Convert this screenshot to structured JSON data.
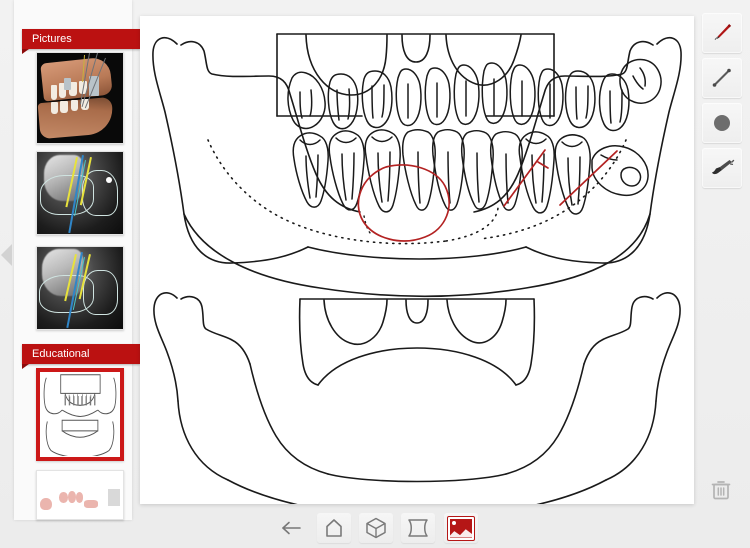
{
  "app": {
    "title": "Dental Panoramic Viewer",
    "background_color": "#efefef",
    "accent_color": "#bb1111",
    "annotation_color": "#b32222"
  },
  "sidebar": {
    "collapse_arrow": "chevron-left-icon",
    "sections": [
      {
        "label": "Pictures",
        "items": [
          {
            "name": "3d-dental-scan",
            "caption": "3D dental scan with implants",
            "selected": false
          },
          {
            "name": "ct-slice-1",
            "caption": "CT cross-section slice 1",
            "selected": false
          },
          {
            "name": "ct-slice-2",
            "caption": "CT cross-section slice 2",
            "selected": false
          }
        ]
      },
      {
        "label": "Educational",
        "items": [
          {
            "name": "panoramic-line-drawing",
            "caption": "Panoramic jaw line drawing",
            "selected": true
          },
          {
            "name": "dental-illustration",
            "caption": "Dental illustration sheet",
            "selected": false
          }
        ]
      }
    ]
  },
  "canvas": {
    "name": "drawing-canvas",
    "illustration": "panoramic-dental-radiograph-line-drawing",
    "top_view_caption": "Dentate maxilla and mandible panoramic outline",
    "bottom_view_caption": "Edentulous mandible outline",
    "annotations": [
      {
        "type": "circle",
        "color": "#b32222",
        "target": "lower-left-molars"
      },
      {
        "type": "slash",
        "color": "#b32222",
        "target": "lower-right-second-molar"
      },
      {
        "type": "slash",
        "color": "#b32222",
        "target": "lower-right-third-molar"
      }
    ]
  },
  "tools": {
    "right_rail": [
      {
        "id": "pencil",
        "label": "Pencil",
        "icon": "pencil-icon",
        "color": "#b51616",
        "active": true
      },
      {
        "id": "line",
        "label": "Line",
        "icon": "line-icon",
        "color": "#5a5a5a",
        "active": false
      },
      {
        "id": "circle",
        "label": "Filled circle",
        "icon": "circle-icon",
        "color": "#6a6a6a",
        "active": false
      },
      {
        "id": "eraser",
        "label": "Eraser",
        "icon": "eraser-icon",
        "color": "#4d4d4d",
        "active": false
      }
    ],
    "delete": {
      "id": "trash",
      "label": "Delete",
      "icon": "trash-icon",
      "color": "#b5b5b5"
    }
  },
  "bottom_bar": {
    "buttons": [
      {
        "id": "back",
        "label": "Back",
        "icon": "arrow-left-icon",
        "active": false
      },
      {
        "id": "home",
        "label": "Home",
        "icon": "home-icon",
        "active": false
      },
      {
        "id": "cube",
        "label": "3D view",
        "icon": "cube-icon",
        "active": false
      },
      {
        "id": "pano",
        "label": "Panoramic view",
        "icon": "panoramic-icon",
        "active": false
      },
      {
        "id": "photo",
        "label": "Pictures",
        "icon": "image-icon",
        "active": true
      }
    ]
  }
}
